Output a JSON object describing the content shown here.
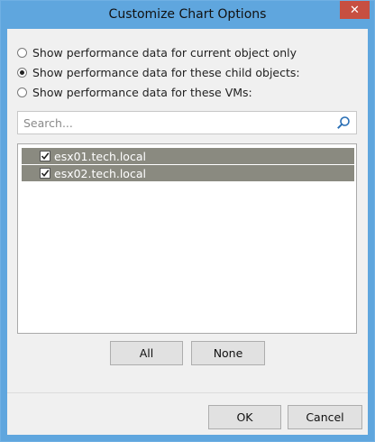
{
  "window": {
    "title": "Customize Chart Options",
    "close_glyph": "✕"
  },
  "options": [
    {
      "label": "Show performance data for current object only",
      "checked": false
    },
    {
      "label": "Show performance data for these child objects:",
      "checked": true
    },
    {
      "label": "Show performance data for these VMs:",
      "checked": false
    }
  ],
  "search": {
    "placeholder": "Search...",
    "value": ""
  },
  "list": {
    "items": [
      {
        "label": "esx01.tech.local",
        "checked": true,
        "selected": true
      },
      {
        "label": "esx02.tech.local",
        "checked": true,
        "selected": true
      }
    ]
  },
  "buttons": {
    "all": "All",
    "none": "None",
    "ok": "OK",
    "cancel": "Cancel"
  },
  "colors": {
    "titlebar": "#5fa6de",
    "close": "#c74f41",
    "selection": "#8a8a80"
  }
}
